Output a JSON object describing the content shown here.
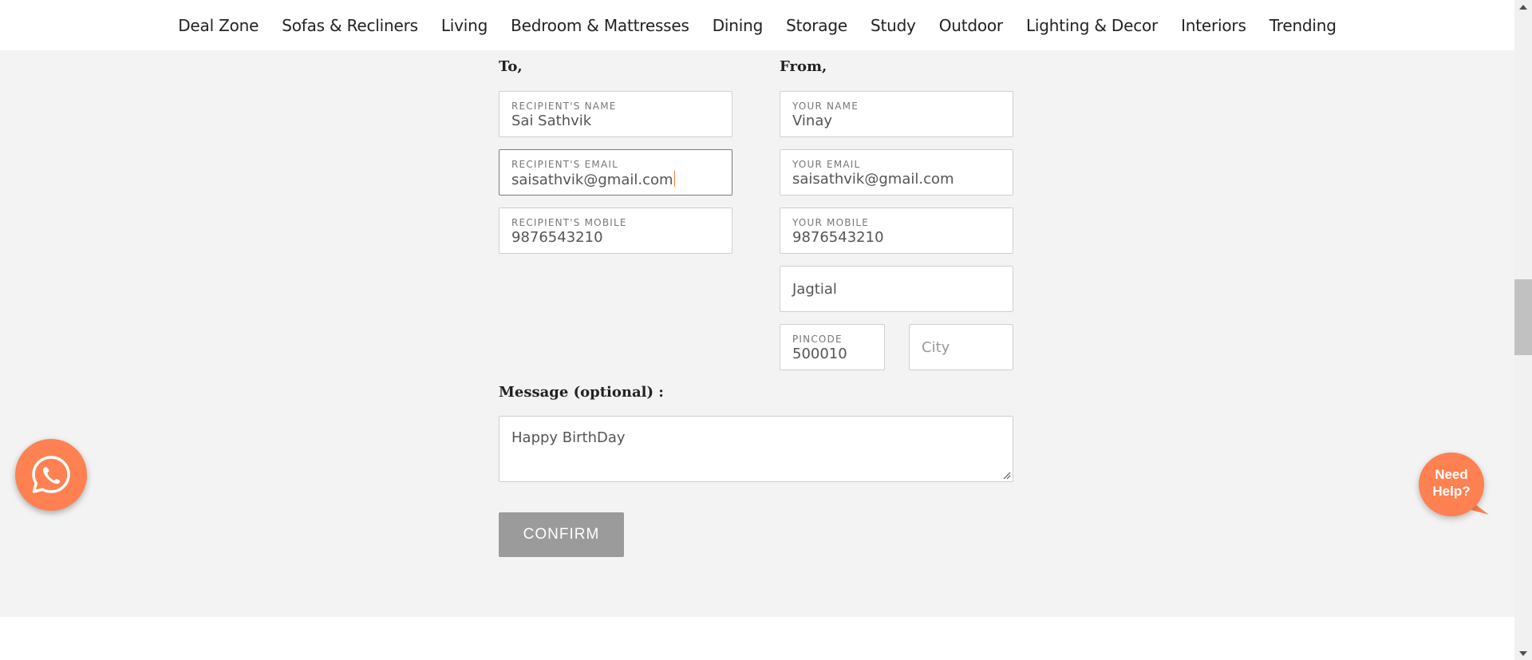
{
  "nav": {
    "items": [
      "Deal Zone",
      "Sofas & Recliners",
      "Living",
      "Bedroom & Mattresses",
      "Dining",
      "Storage",
      "Study",
      "Outdoor",
      "Lighting & Decor",
      "Interiors",
      "Trending"
    ]
  },
  "form": {
    "to_heading": "To,",
    "from_heading": "From,",
    "recipient_name": {
      "label": "RECIPIENT'S NAME",
      "value": "Sai Sathvik"
    },
    "recipient_email": {
      "label": "RECIPIENT'S EMAIL",
      "value": "saisathvik@gmail.com"
    },
    "recipient_mobile": {
      "label": "RECIPIENT'S MOBILE",
      "value": "9876543210"
    },
    "your_name": {
      "label": "YOUR NAME",
      "value": "Vinay"
    },
    "your_email": {
      "label": "YOUR EMAIL",
      "value": "saisathvik@gmail.com"
    },
    "your_mobile": {
      "label": "YOUR MOBILE",
      "value": "9876543210"
    },
    "address": {
      "value": "Jagtial"
    },
    "pincode": {
      "label": "PINCODE",
      "value": "500010"
    },
    "city": {
      "placeholder": "City"
    },
    "message_heading": "Message (optional) :",
    "message": {
      "value": "Happy BirthDay"
    },
    "confirm_label": "CONFIRM"
  },
  "help": {
    "need_help_line1": "Need",
    "need_help_line2": "Help?"
  },
  "colors": {
    "accent": "#ff8051",
    "page_bg": "#f3f3f3",
    "button_disabled": "#9b9b9b"
  },
  "icons": {
    "whatsapp": "whatsapp-icon",
    "resize": "resize-handle-icon"
  }
}
